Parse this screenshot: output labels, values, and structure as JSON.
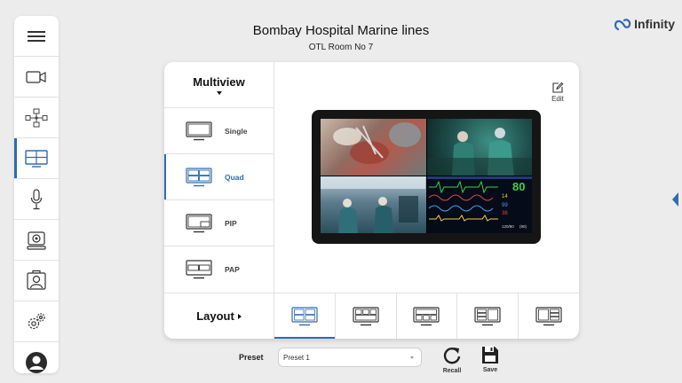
{
  "header": {
    "title": "Bombay Hospital Marine lines",
    "subtitle": "OTL Room No 7"
  },
  "brand": {
    "logo_text": "Infinity",
    "accent_color": "#2f6bb3"
  },
  "sidebar": {
    "items": [
      {
        "icon": "menu-icon"
      },
      {
        "icon": "video-camera-icon"
      },
      {
        "icon": "network-icon"
      },
      {
        "icon": "multiview-icon",
        "active": true
      },
      {
        "icon": "microphone-icon"
      },
      {
        "icon": "webcam-icon"
      },
      {
        "icon": "doctor-display-icon"
      },
      {
        "icon": "settings-icon"
      },
      {
        "icon": "user-profile-icon"
      }
    ]
  },
  "multiview": {
    "title": "Multiview",
    "modes": [
      {
        "label": "Single",
        "active": false
      },
      {
        "label": "Quad",
        "active": true
      },
      {
        "label": "PIP",
        "active": false
      },
      {
        "label": "PAP",
        "active": false
      }
    ]
  },
  "preview": {
    "edit_label": "Edit",
    "vitals": {
      "hr": "80",
      "v2": "14",
      "v3": "99",
      "v4": "38",
      "bp": "120/80",
      "unit": "(90)"
    }
  },
  "layout": {
    "label": "Layout",
    "options_count": 5,
    "active_index": 0
  },
  "preset": {
    "label": "Preset",
    "selected": "Preset 1",
    "recall_label": "Recall",
    "save_label": "Save"
  }
}
